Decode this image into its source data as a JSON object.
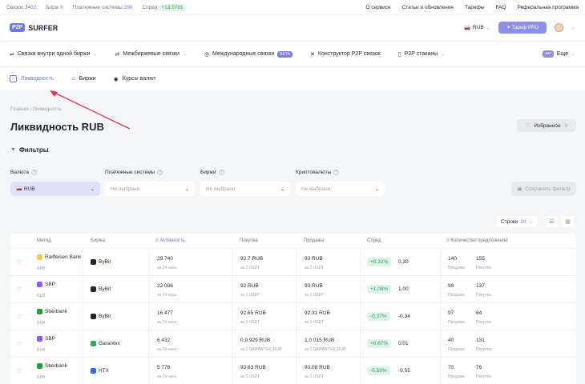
{
  "topbar": {
    "links_label": "Связок",
    "links_value": "3402",
    "exchanges_label": "Бирж",
    "exchanges_value": "9",
    "payments_label": "Платежные системы",
    "payments_value": "290",
    "spread_label": "Спред",
    "spread_value": "+13.5781",
    "menu": [
      "О сервисе",
      "Статьи и обновления",
      "Тарифы",
      "FAQ",
      "Реферальная программа"
    ]
  },
  "header": {
    "logo_badge": "P2P",
    "logo_text": "SURFER",
    "currency": "RUB",
    "pro_button": "Тариф PRO"
  },
  "nav1": {
    "items": [
      "Связки внутри одной биржи",
      "Межбиржевые связки",
      "Международные связки",
      "Конструктор P2P связок",
      "P2P стаканы"
    ],
    "beta": "BETA",
    "more": "Еще",
    "more_dots": "•••"
  },
  "nav2": {
    "items": [
      "Ликвидность",
      "Биржи",
      "Курсы валют"
    ]
  },
  "breadcrumb": "Главная  ›  Ликвидность",
  "page_title": "Ликвидность RUB",
  "favorites": {
    "label": "Избранное",
    "count": "0"
  },
  "filters": {
    "heading": "Фильтры",
    "currency_label": "Валюта",
    "currency_value": "RUB",
    "payment_label": "Платежные системы",
    "payment_placeholder": "Не выбрано",
    "exchanges_label": "Биржи",
    "exchanges_placeholder": "Не выбрано",
    "crypto_label": "Криптовалюты",
    "crypto_placeholder": "Не выбрано",
    "save_button": "Сохранить фильтр"
  },
  "table_controls": {
    "rows_label": "Строки",
    "rows_value": "20"
  },
  "table": {
    "headers": [
      "Метод",
      "Биржа",
      "Активность",
      "Покупка",
      "Продажа",
      "Спред",
      "Количество предложений"
    ],
    "rows": [
      {
        "method": "Raiffeisen Bank",
        "method_sub": "RUB",
        "method_color": "#f2c94c",
        "exchange": "ByBit",
        "exchange_color": "#1d2433",
        "activity": "29 740",
        "activity_sub": "за 24 часа",
        "buy": "92.7 RUB",
        "buy_sub": "за 1 USDT",
        "sell": "93 RUB",
        "sell_sub": "за 1 USDT",
        "spread_pct": "+0.32%",
        "spread_abs": "0.30",
        "sell_count": "140",
        "sell_count_label": "Продажа",
        "buy_count": "155",
        "buy_count_label": "Покупка"
      },
      {
        "method": "SBP",
        "method_sub": "RUB",
        "method_color": "#8b5cf6",
        "exchange": "ByBit",
        "exchange_color": "#1d2433",
        "activity": "22 006",
        "activity_sub": "за 24 часа",
        "buy": "92 RUB",
        "buy_sub": "за 1 USDT",
        "sell": "93 RUB",
        "sell_sub": "за 1 USDT",
        "spread_pct": "+1.09%",
        "spread_abs": "1.00",
        "sell_count": "99",
        "sell_count_label": "Продажа",
        "buy_count": "137",
        "buy_count_label": "Покупка"
      },
      {
        "method": "Sberbank",
        "method_sub": "RUB",
        "method_color": "#21a038",
        "exchange": "ByBit",
        "exchange_color": "#1d2433",
        "activity": "16 477",
        "activity_sub": "за 24 часа",
        "buy": "92.65 RUB",
        "buy_sub": "за 1 USDT",
        "sell": "92.31 RUB",
        "sell_sub": "за 1 USDT",
        "spread_pct": "-0.37%",
        "spread_abs": "-0.34",
        "sell_count": "97",
        "sell_count_label": "Продажа",
        "buy_count": "84",
        "buy_count_label": "Покупка"
      },
      {
        "method": "SBP",
        "method_sub": "RUB",
        "method_color": "#8b5cf6",
        "exchange": "Garantex",
        "exchange_color": "#27ae60",
        "activity": "6 432",
        "activity_sub": "за 24 часа",
        "buy": "0.9 929 RUB",
        "buy_sub": "за 1 GARANTEX_RUB",
        "sell": "1.0 015 RUB",
        "sell_sub": "за 1 GARANTEX_RUB",
        "spread_pct": "+0.87%",
        "spread_abs": "0.01",
        "sell_count": "40",
        "sell_count_label": "Продажа",
        "buy_count": "131",
        "buy_count_label": "Покупка"
      },
      {
        "method": "Sberbank",
        "method_sub": "RUB",
        "method_color": "#21a038",
        "exchange": "HTX",
        "exchange_color": "#2d6cdf",
        "activity": "5 776",
        "activity_sub": "за 24 часа",
        "buy": "93.63 RUB",
        "buy_sub": "за 1 USDT",
        "sell": "93.08 RUB",
        "sell_sub": "за 1 USDT",
        "spread_pct": "-0.59%",
        "spread_abs": "-0.55",
        "sell_count": "70",
        "sell_count_label": "Продажа",
        "buy_count": "76",
        "buy_count_label": "Покупка"
      }
    ]
  },
  "colors": {
    "accent": "#6c7bd9",
    "positive": "#2f9e5a",
    "arrow": "#e0334f"
  }
}
